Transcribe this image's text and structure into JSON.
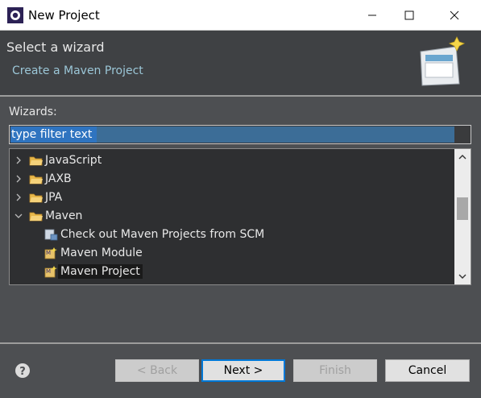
{
  "window": {
    "title": "New Project",
    "minimize_icon": "minimize-icon",
    "maximize_icon": "maximize-icon",
    "close_icon": "close-icon"
  },
  "header": {
    "heading": "Select a wizard",
    "description": "Create a Maven Project",
    "banner_icon": "wizard-banner-icon"
  },
  "wizards": {
    "label": "Wizards:",
    "filter": {
      "value": "type filter text",
      "placeholder": "type filter text"
    },
    "tree": [
      {
        "label": "JavaScript",
        "type": "folder",
        "expanded": false
      },
      {
        "label": "JAXB",
        "type": "folder",
        "expanded": false
      },
      {
        "label": "JPA",
        "type": "folder",
        "expanded": false
      },
      {
        "label": "Maven",
        "type": "folder",
        "expanded": true
      },
      {
        "label": "Check out Maven Projects from SCM",
        "type": "item"
      },
      {
        "label": "Maven Module",
        "type": "item"
      },
      {
        "label": "Maven Project",
        "type": "item",
        "selected": true
      }
    ]
  },
  "buttons": {
    "help_icon": "help-icon",
    "back": "< Back",
    "next": "Next >",
    "finish": "Finish",
    "cancel": "Cancel"
  },
  "colors": {
    "background": "#4d4f52",
    "header_bg": "#3f4144",
    "description_text": "#9bc6d7",
    "tree_bg": "#2e2f31",
    "default_button_border": "#0078d7"
  }
}
